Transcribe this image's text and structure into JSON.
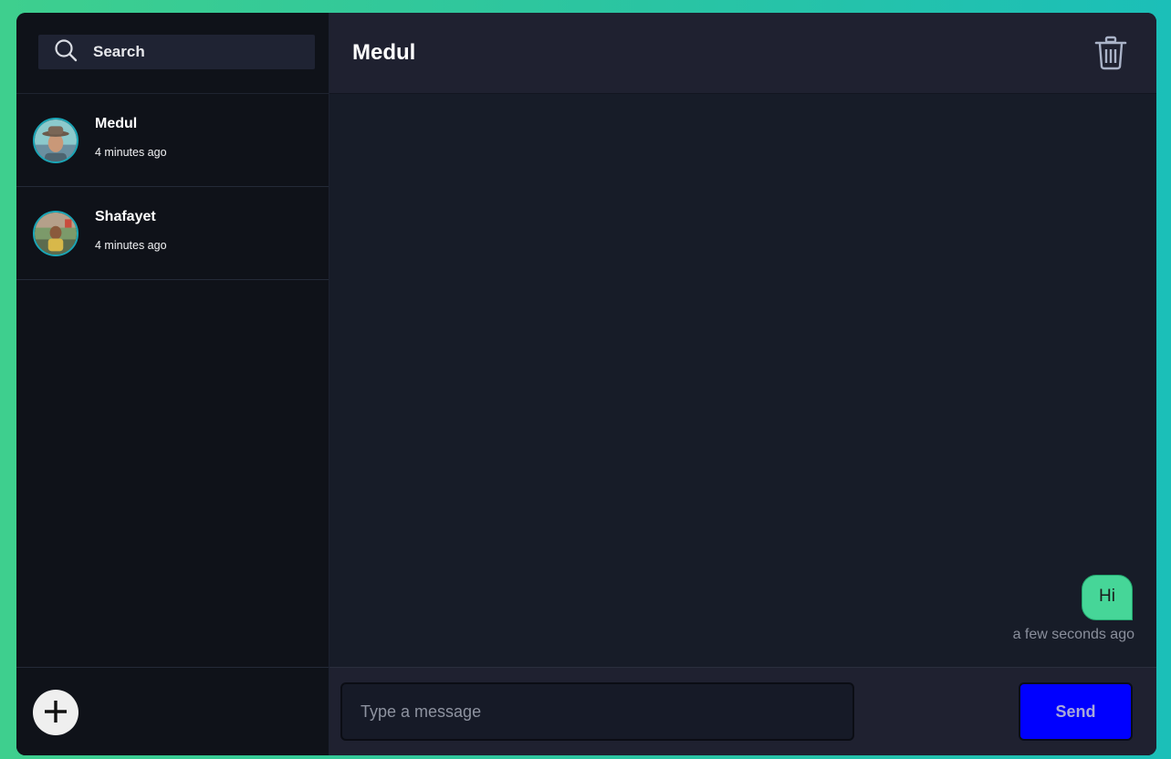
{
  "search": {
    "placeholder": "Search",
    "icon": "search-icon"
  },
  "contacts": [
    {
      "name": "Medul",
      "time": "4 minutes ago",
      "avatar": "avatar-medul"
    },
    {
      "name": "Shafayet",
      "time": "4 minutes ago",
      "avatar": "avatar-shafayet"
    }
  ],
  "sidebar_footer": {
    "add_icon": "plus-icon"
  },
  "chat": {
    "title": "Medul",
    "delete_icon": "trash-icon",
    "messages": [
      {
        "text": "Hi",
        "time": "a few seconds ago",
        "outgoing": true
      }
    ]
  },
  "composer": {
    "placeholder": "Type a message",
    "send_label": "Send"
  },
  "colors": {
    "background_gradient": [
      "#3ecf8e",
      "#1bbfb8"
    ],
    "sidebar_bg": "#0f1219",
    "main_bg": "#171c28",
    "bubble": "#46d698",
    "send_button": "#0000ff",
    "avatar_ring": "#1aa6b7"
  }
}
